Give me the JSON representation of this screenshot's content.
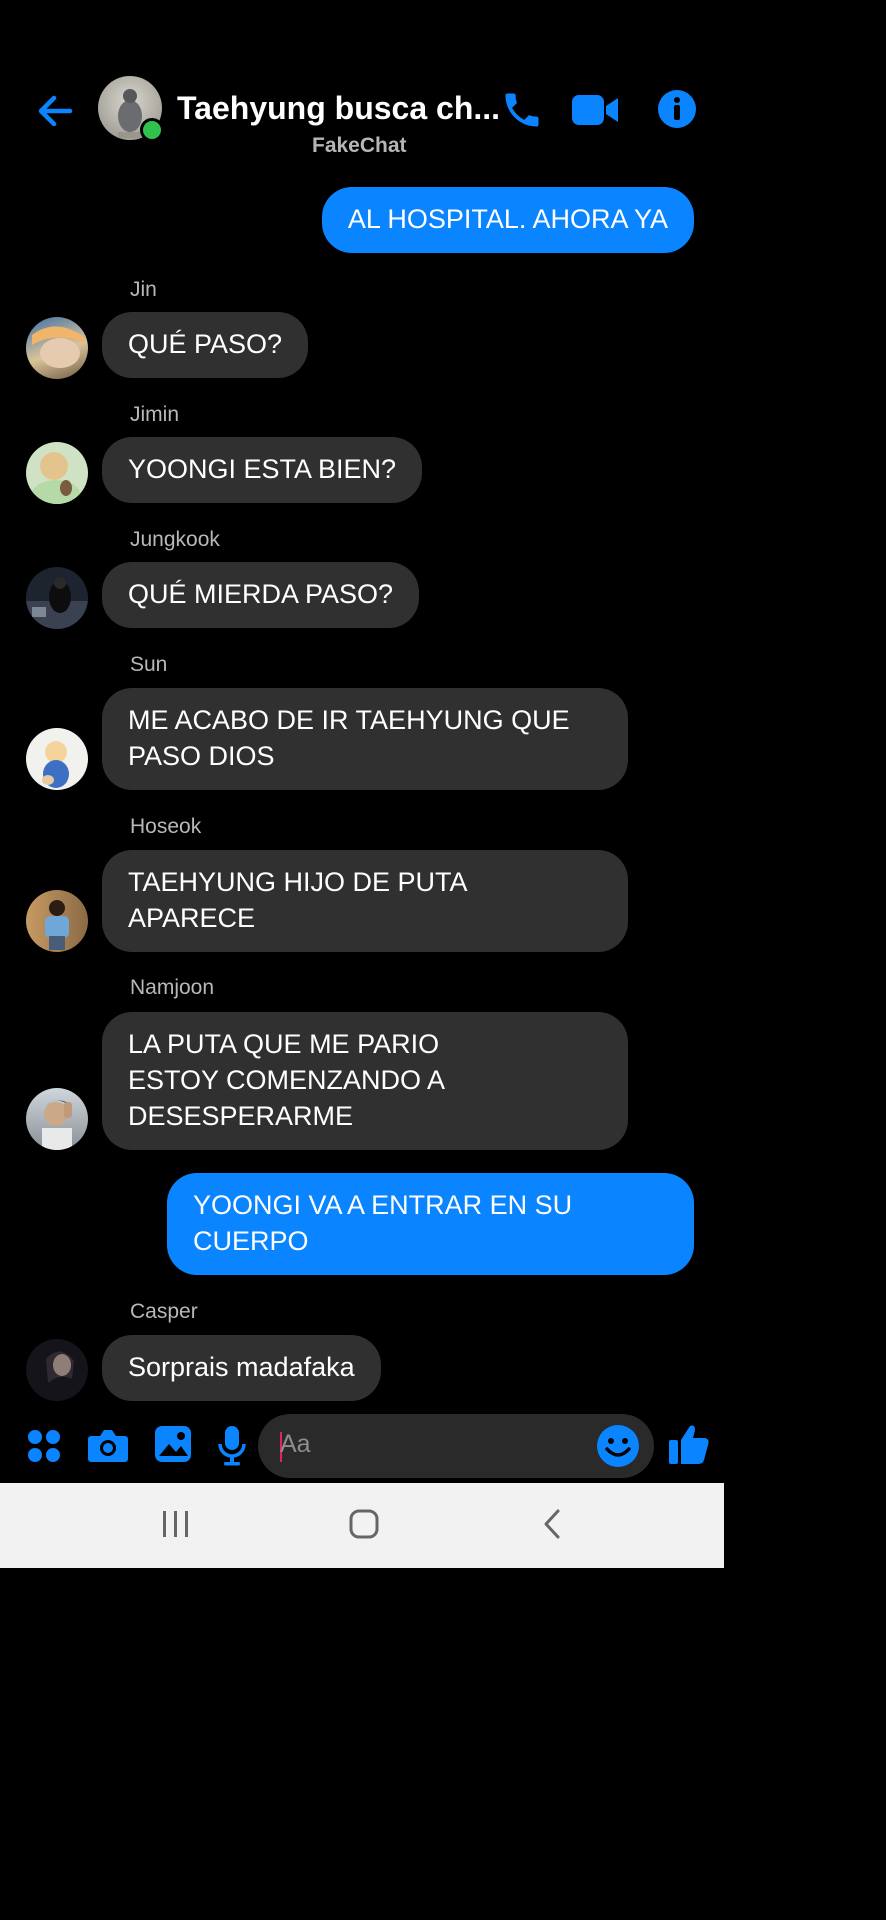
{
  "header": {
    "title": "Taehyung busca ch...",
    "subtitle": "FakeChat",
    "accent": "#0a84ff"
  },
  "messages": [
    {
      "type": "out",
      "text": "AL HOSPITAL. AHORA YA"
    },
    {
      "type": "in",
      "sender": "Jin",
      "text": "QUÉ PASO?"
    },
    {
      "type": "in",
      "sender": "Jimin",
      "text": "YOONGI ESTA BIEN?"
    },
    {
      "type": "in",
      "sender": "Jungkook",
      "text": "QUÉ MIERDA PASO?"
    },
    {
      "type": "in",
      "sender": "Sun",
      "lines": [
        "ME ACABO DE IR TAEHYUNG QUE",
        "PASO DIOS"
      ]
    },
    {
      "type": "in",
      "sender": "Hoseok",
      "lines": [
        "TAEHYUNG HIJO DE PUTA",
        "APARECE"
      ]
    },
    {
      "type": "in",
      "sender": "Namjoon",
      "lines": [
        "LA PUTA QUE ME PARIO",
        "ESTOY COMENZANDO A",
        "DESESPERARME"
      ]
    },
    {
      "type": "out",
      "lines": [
        "YOONGI VA A ENTRAR EN SU",
        "CUERPO"
      ]
    },
    {
      "type": "in",
      "sender": "Casper",
      "text": "Sorprais madafaka"
    }
  ],
  "composer": {
    "placeholder": "Aa",
    "icons": [
      "apps-icon",
      "camera-icon",
      "gallery-icon",
      "mic-icon",
      "emoji-icon",
      "thumbs-up-icon"
    ]
  },
  "system_nav": {
    "icons": [
      "recent-apps-icon",
      "home-icon",
      "back-nav-icon"
    ]
  }
}
